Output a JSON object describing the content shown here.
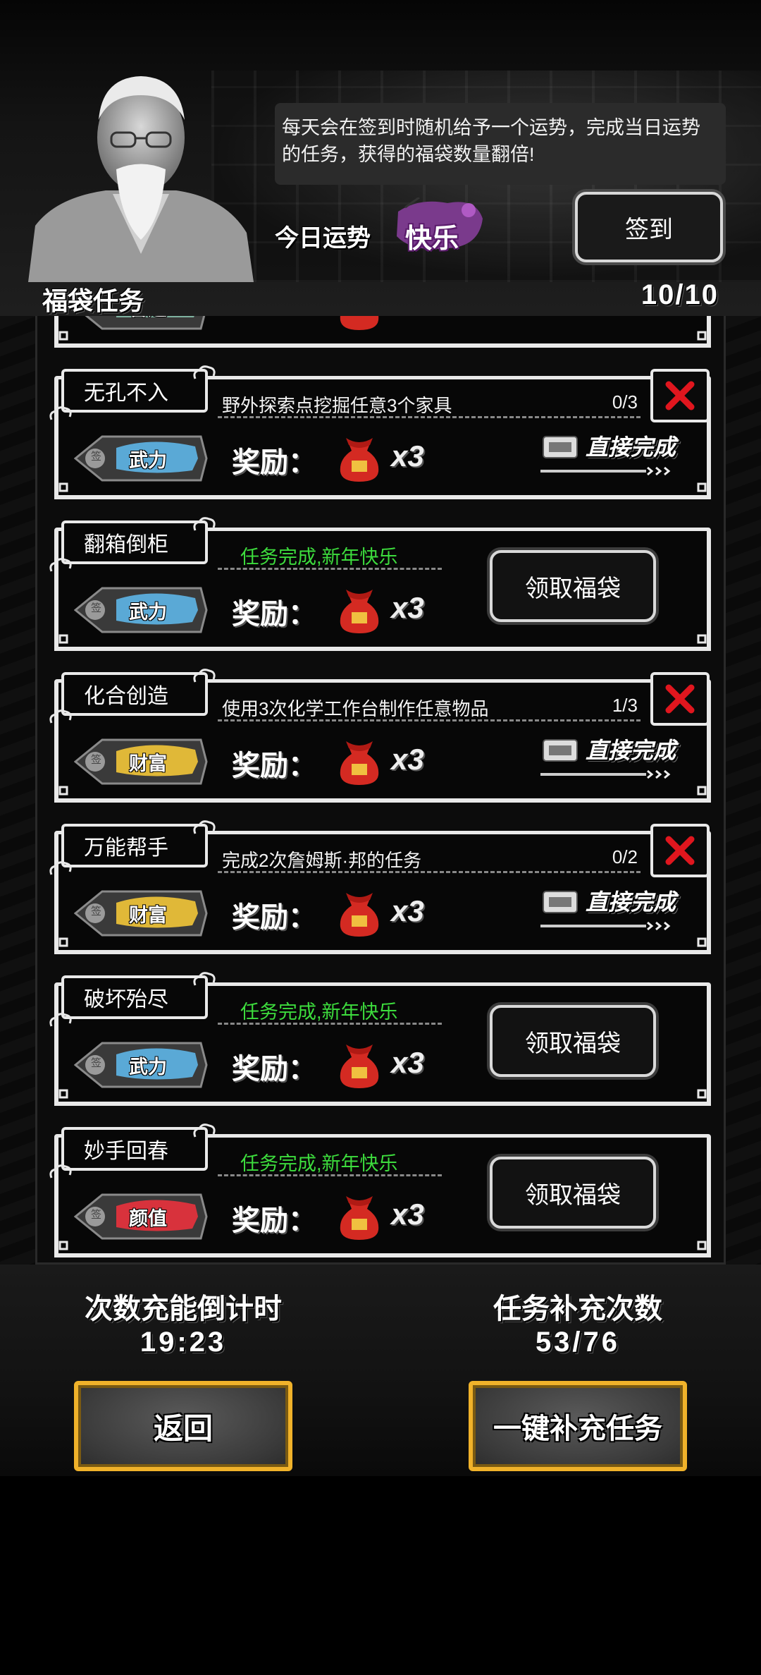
{
  "header": {
    "speech": "每天会在签到时随机给予一个运势，完成当日运势的任务，获得的福袋数量翻倍!",
    "fortune_label": "今日运势",
    "fortune_value": "快乐",
    "signin_label": "签到",
    "section_title": "福袋任务",
    "section_count": "10/10"
  },
  "tasks": [
    {
      "name": "无孔不入",
      "desc": "野外探索点挖掘任意3个家具",
      "progress": "0/3",
      "tag": "武力",
      "tag_color": "#5aa9d6",
      "reward_label": "奖励：",
      "qty": "x3",
      "direct": "直接完成"
    },
    {
      "name": "翻箱倒柜",
      "done_text": "任务完成,新年快乐",
      "tag": "武力",
      "tag_color": "#5aa9d6",
      "reward_label": "奖励：",
      "qty": "x3",
      "claim": "领取福袋"
    },
    {
      "name": "化合创造",
      "desc": "使用3次化学工作台制作任意物品",
      "progress": "1/3",
      "tag": "财富",
      "tag_color": "#e0b838",
      "reward_label": "奖励：",
      "qty": "x3",
      "direct": "直接完成"
    },
    {
      "name": "万能帮手",
      "desc": "完成2次詹姆斯·邦的任务",
      "progress": "0/2",
      "tag": "财富",
      "tag_color": "#e0b838",
      "reward_label": "奖励：",
      "qty": "x3",
      "direct": "直接完成"
    },
    {
      "name": "破坏殆尽",
      "done_text": "任务完成,新年快乐",
      "tag": "武力",
      "tag_color": "#5aa9d6",
      "reward_label": "奖励：",
      "qty": "x3",
      "claim": "领取福袋"
    },
    {
      "name": "妙手回春",
      "done_text": "任务完成,新年快乐",
      "tag": "颜值",
      "tag_color": "#d8323c",
      "reward_label": "奖励：",
      "qty": "x3",
      "claim": "领取福袋"
    }
  ],
  "partial_top_tag": "普通",
  "sign_char": "签",
  "bottom": {
    "countdown_label": "次数充能倒计时",
    "countdown_value": "19:23",
    "refill_label": "任务补充次数",
    "refill_value": "53/76",
    "back_label": "返回",
    "refill_button_label": "一键补充任务"
  },
  "colors": {
    "done_green": "#3ddc3d",
    "close_red": "#e0161e",
    "gold": "#f0b22a",
    "bag_red": "#d42a22"
  }
}
